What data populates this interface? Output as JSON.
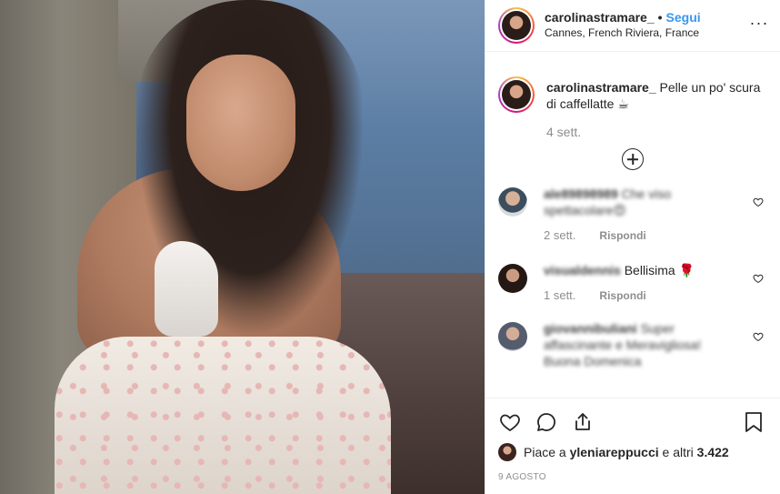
{
  "post": {
    "author": "carolinastramare_",
    "separator": "•",
    "follow_label": "Segui",
    "location": "Cannes, French Riviera, France",
    "more_label": "···"
  },
  "caption": {
    "username": "carolinastramare_",
    "text": "Pelle un po' scura di caffellatte ☕",
    "time": "4 sett."
  },
  "comments": [
    {
      "username": "ale89898989",
      "text": "Che viso spettacolare😍",
      "time": "2 sett.",
      "reply_label": "Rispondi"
    },
    {
      "username": "visualdennis",
      "text": "Bellisima 🌹",
      "time": "1 sett.",
      "reply_label": "Rispondi"
    },
    {
      "username": "giovannibuliani",
      "text": "Super affascinante e Meravigliosa! Buona Domenica",
      "time": "",
      "reply_label": ""
    }
  ],
  "likes": {
    "prefix": "Piace a",
    "user": "yleniareppucci",
    "suffix": "e altri",
    "count": "3.422"
  },
  "date": "9 AGOSTO",
  "icons": {
    "more": "more-horizontal-icon",
    "load_more": "plus-circle-icon",
    "comment_like": "heart-outline-icon",
    "like": "heart-icon",
    "comment": "comment-icon",
    "share": "share-icon",
    "save": "bookmark-icon"
  },
  "colors": {
    "accent_link": "#3897f0",
    "text": "#262626",
    "muted": "#8e8e8e",
    "divider": "#efefef"
  }
}
